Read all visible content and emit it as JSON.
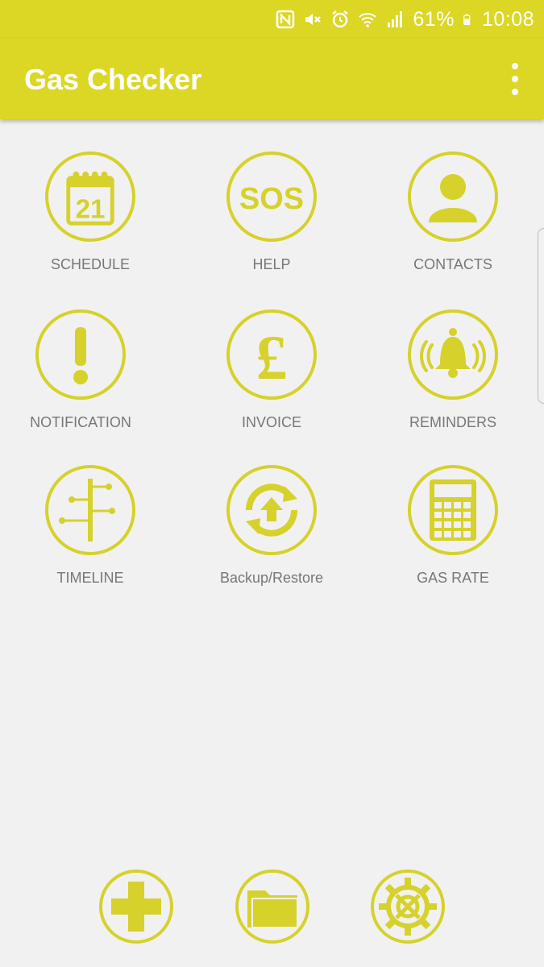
{
  "status_bar": {
    "battery": "61%",
    "time": "10:08",
    "icons": [
      "nfc-icon",
      "mute-icon",
      "alarm-icon",
      "wifi-icon",
      "signal-icon",
      "battery-icon"
    ]
  },
  "app_bar": {
    "title": "Gas Checker",
    "menu_icon": "more-vert-icon"
  },
  "grid": [
    {
      "label": "SCHEDULE",
      "icon": "calendar-21-icon"
    },
    {
      "label": "HELP",
      "icon": "sos-icon"
    },
    {
      "label": "CONTACTS",
      "icon": "person-icon"
    },
    {
      "label": "NOTIFICATION",
      "icon": "exclamation-icon"
    },
    {
      "label": "INVOICE",
      "icon": "pound-icon"
    },
    {
      "label": "REMINDERS",
      "icon": "bell-icon"
    },
    {
      "label": "TIMELINE",
      "icon": "timeline-icon"
    },
    {
      "label": "Backup/Restore",
      "icon": "sync-upload-icon"
    },
    {
      "label": "GAS RATE",
      "icon": "calculator-icon"
    }
  ],
  "bottom_bar": {
    "icons": [
      "plus-icon",
      "folder-icon",
      "settings-gear-icon"
    ]
  },
  "colors": {
    "accent": "#dcd625",
    "icon": "#d6d12b",
    "background": "#f1f1f1",
    "label": "#777777"
  }
}
